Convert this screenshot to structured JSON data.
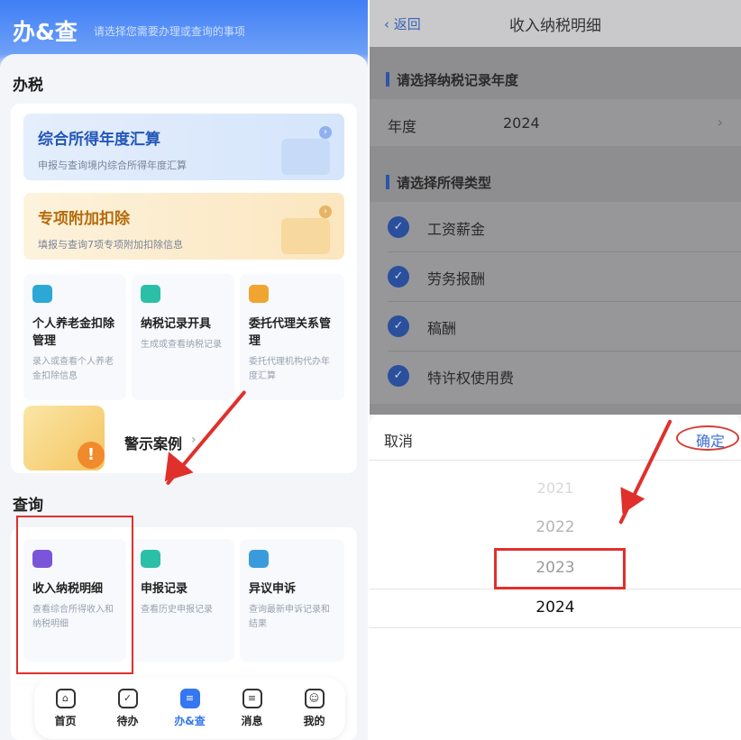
{
  "left": {
    "header": {
      "title": "办&查",
      "subtitle": "请选择您需要办理或查询的事项"
    },
    "tax_section_title": "办税",
    "banners": [
      {
        "title": "综合所得年度汇算",
        "subtitle": "申报与查询境内综合所得年度汇算"
      },
      {
        "title": "专项附加扣除",
        "subtitle": "填报与查询7项专项附加扣除信息"
      }
    ],
    "tiles": [
      {
        "title": "个人养老金扣除管理",
        "subtitle": "录入或查看个人养老金扣除信息"
      },
      {
        "title": "纳税记录开具",
        "subtitle": "生成或查看纳税记录"
      },
      {
        "title": "委托代理关系管理",
        "subtitle": "委托代理机构代办年度汇算"
      }
    ],
    "warning": {
      "label": "警示案例",
      "chevron": "›"
    },
    "query_section_title": "查询",
    "query_tiles": [
      {
        "title": "收入纳税明细",
        "subtitle": "查看综合所得收入和纳税明细"
      },
      {
        "title": "申报记录",
        "subtitle": "查看历史申报记录"
      },
      {
        "title": "异议申诉",
        "subtitle": "查询最新申诉记录和结果"
      }
    ],
    "tabbar": [
      {
        "label": "首页",
        "icon": "home-icon",
        "glyph": "⌂"
      },
      {
        "label": "待办",
        "icon": "calendar-icon",
        "glyph": "✓"
      },
      {
        "label": "办&查",
        "icon": "task-icon",
        "glyph": "≡",
        "active": true
      },
      {
        "label": "消息",
        "icon": "message-icon",
        "glyph": "≡"
      },
      {
        "label": "我的",
        "icon": "profile-icon",
        "glyph": "☺"
      }
    ]
  },
  "right": {
    "back_label": "返回",
    "title": "收入纳税明细",
    "year_section": "请选择纳税记录年度",
    "year_label": "年度",
    "year_value": "2024",
    "type_section": "请选择所得类型",
    "types": [
      "工资薪金",
      "劳务报酬",
      "稿酬",
      "特许权使用费"
    ],
    "picker": {
      "cancel": "取消",
      "confirm": "确定",
      "years": [
        "2021",
        "2022",
        "2023",
        "2024"
      ]
    }
  },
  "colors": {
    "brand_blue": "#3577f0",
    "annotation_red": "#e0302c"
  }
}
